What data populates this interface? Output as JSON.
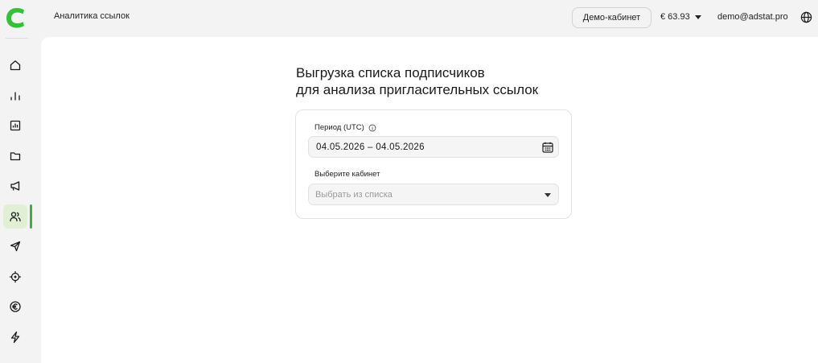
{
  "header": {
    "title": "Аналитика ссылок",
    "demo_button": "Демо-кабинет",
    "balance": "€ 63.93",
    "email": "demo@adstat.pro"
  },
  "sidebar": {
    "items": [
      {
        "icon": "home-icon"
      },
      {
        "icon": "bar-chart-icon"
      },
      {
        "icon": "report-icon"
      },
      {
        "icon": "folder-icon"
      },
      {
        "icon": "megaphone-icon"
      },
      {
        "icon": "users-icon",
        "active": true
      },
      {
        "icon": "send-icon"
      },
      {
        "icon": "target-icon"
      },
      {
        "icon": "euro-icon"
      },
      {
        "icon": "lightning-icon"
      }
    ]
  },
  "main": {
    "heading_line1": "Выгрузка списка подписчиков",
    "heading_line2": "для анализа пригласительных ссылок",
    "period_label": "Период (UTC)",
    "period_value": "04.05.2026 – 04.05.2026",
    "cabinet_label": "Выберите кабинет",
    "cabinet_placeholder": "Выбрать из списка"
  },
  "colors": {
    "accent": "#35b535",
    "active_bg": "#e1f0d4"
  }
}
